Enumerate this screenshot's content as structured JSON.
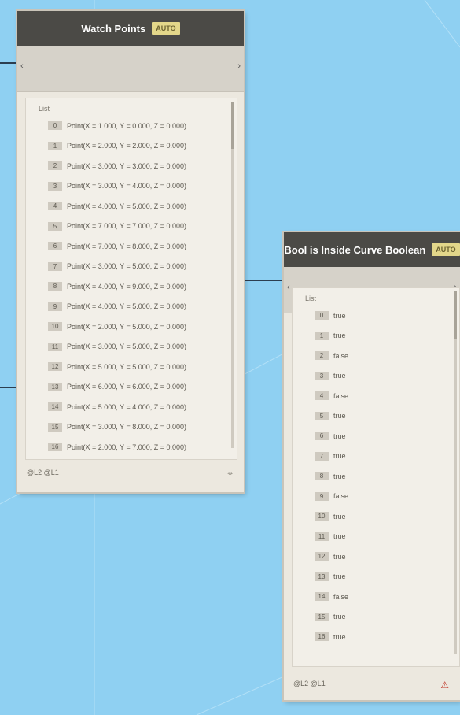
{
  "colors": {
    "canvas": "#8fd0f2",
    "header": "#4b4a46",
    "node_body": "#ece8df",
    "badge": "#e3d78a",
    "connector": "#2c3e50",
    "error_icon": "#c0392b"
  },
  "node_left": {
    "title": "Watch Points",
    "badge": "AUTO",
    "input_marker": "‹",
    "output_marker": "›",
    "list_title": "List",
    "footer_level": "@L2 @L1",
    "footer_icon": "pin-icon",
    "rows": [
      {
        "index": "0",
        "text": "Point(X = 1.000, Y = 0.000, Z = 0.000)"
      },
      {
        "index": "1",
        "text": "Point(X = 2.000, Y = 2.000, Z = 0.000)"
      },
      {
        "index": "2",
        "text": "Point(X = 3.000, Y = 3.000, Z = 0.000)"
      },
      {
        "index": "3",
        "text": "Point(X = 3.000, Y = 4.000, Z = 0.000)"
      },
      {
        "index": "4",
        "text": "Point(X = 4.000, Y = 5.000, Z = 0.000)"
      },
      {
        "index": "5",
        "text": "Point(X = 7.000, Y = 7.000, Z = 0.000)"
      },
      {
        "index": "6",
        "text": "Point(X = 7.000, Y = 8.000, Z = 0.000)"
      },
      {
        "index": "7",
        "text": "Point(X = 3.000, Y = 5.000, Z = 0.000)"
      },
      {
        "index": "8",
        "text": "Point(X = 4.000, Y = 9.000, Z = 0.000)"
      },
      {
        "index": "9",
        "text": "Point(X = 4.000, Y = 5.000, Z = 0.000)"
      },
      {
        "index": "10",
        "text": "Point(X = 2.000, Y = 5.000, Z = 0.000)"
      },
      {
        "index": "11",
        "text": "Point(X = 3.000, Y = 5.000, Z = 0.000)"
      },
      {
        "index": "12",
        "text": "Point(X = 5.000, Y = 5.000, Z = 0.000)"
      },
      {
        "index": "13",
        "text": "Point(X = 6.000, Y = 6.000, Z = 0.000)"
      },
      {
        "index": "14",
        "text": "Point(X = 5.000, Y = 4.000, Z = 0.000)"
      },
      {
        "index": "15",
        "text": "Point(X = 3.000, Y = 8.000, Z = 0.000)"
      },
      {
        "index": "16",
        "text": "Point(X = 2.000, Y = 7.000, Z = 0.000)"
      }
    ]
  },
  "node_right": {
    "title": "Bool is Inside Curve Boolean",
    "badge": "AUTO",
    "input_marker": "‹",
    "output_marker": "›",
    "list_title": "List",
    "footer_level": "@L2 @L1",
    "footer_icon": "warning-icon",
    "rows": [
      {
        "index": "0",
        "text": "true"
      },
      {
        "index": "1",
        "text": "true"
      },
      {
        "index": "2",
        "text": "false"
      },
      {
        "index": "3",
        "text": "true"
      },
      {
        "index": "4",
        "text": "false"
      },
      {
        "index": "5",
        "text": "true"
      },
      {
        "index": "6",
        "text": "true"
      },
      {
        "index": "7",
        "text": "true"
      },
      {
        "index": "8",
        "text": "true"
      },
      {
        "index": "9",
        "text": "false"
      },
      {
        "index": "10",
        "text": "true"
      },
      {
        "index": "11",
        "text": "true"
      },
      {
        "index": "12",
        "text": "true"
      },
      {
        "index": "13",
        "text": "true"
      },
      {
        "index": "14",
        "text": "false"
      },
      {
        "index": "15",
        "text": "true"
      },
      {
        "index": "16",
        "text": "true"
      }
    ]
  }
}
